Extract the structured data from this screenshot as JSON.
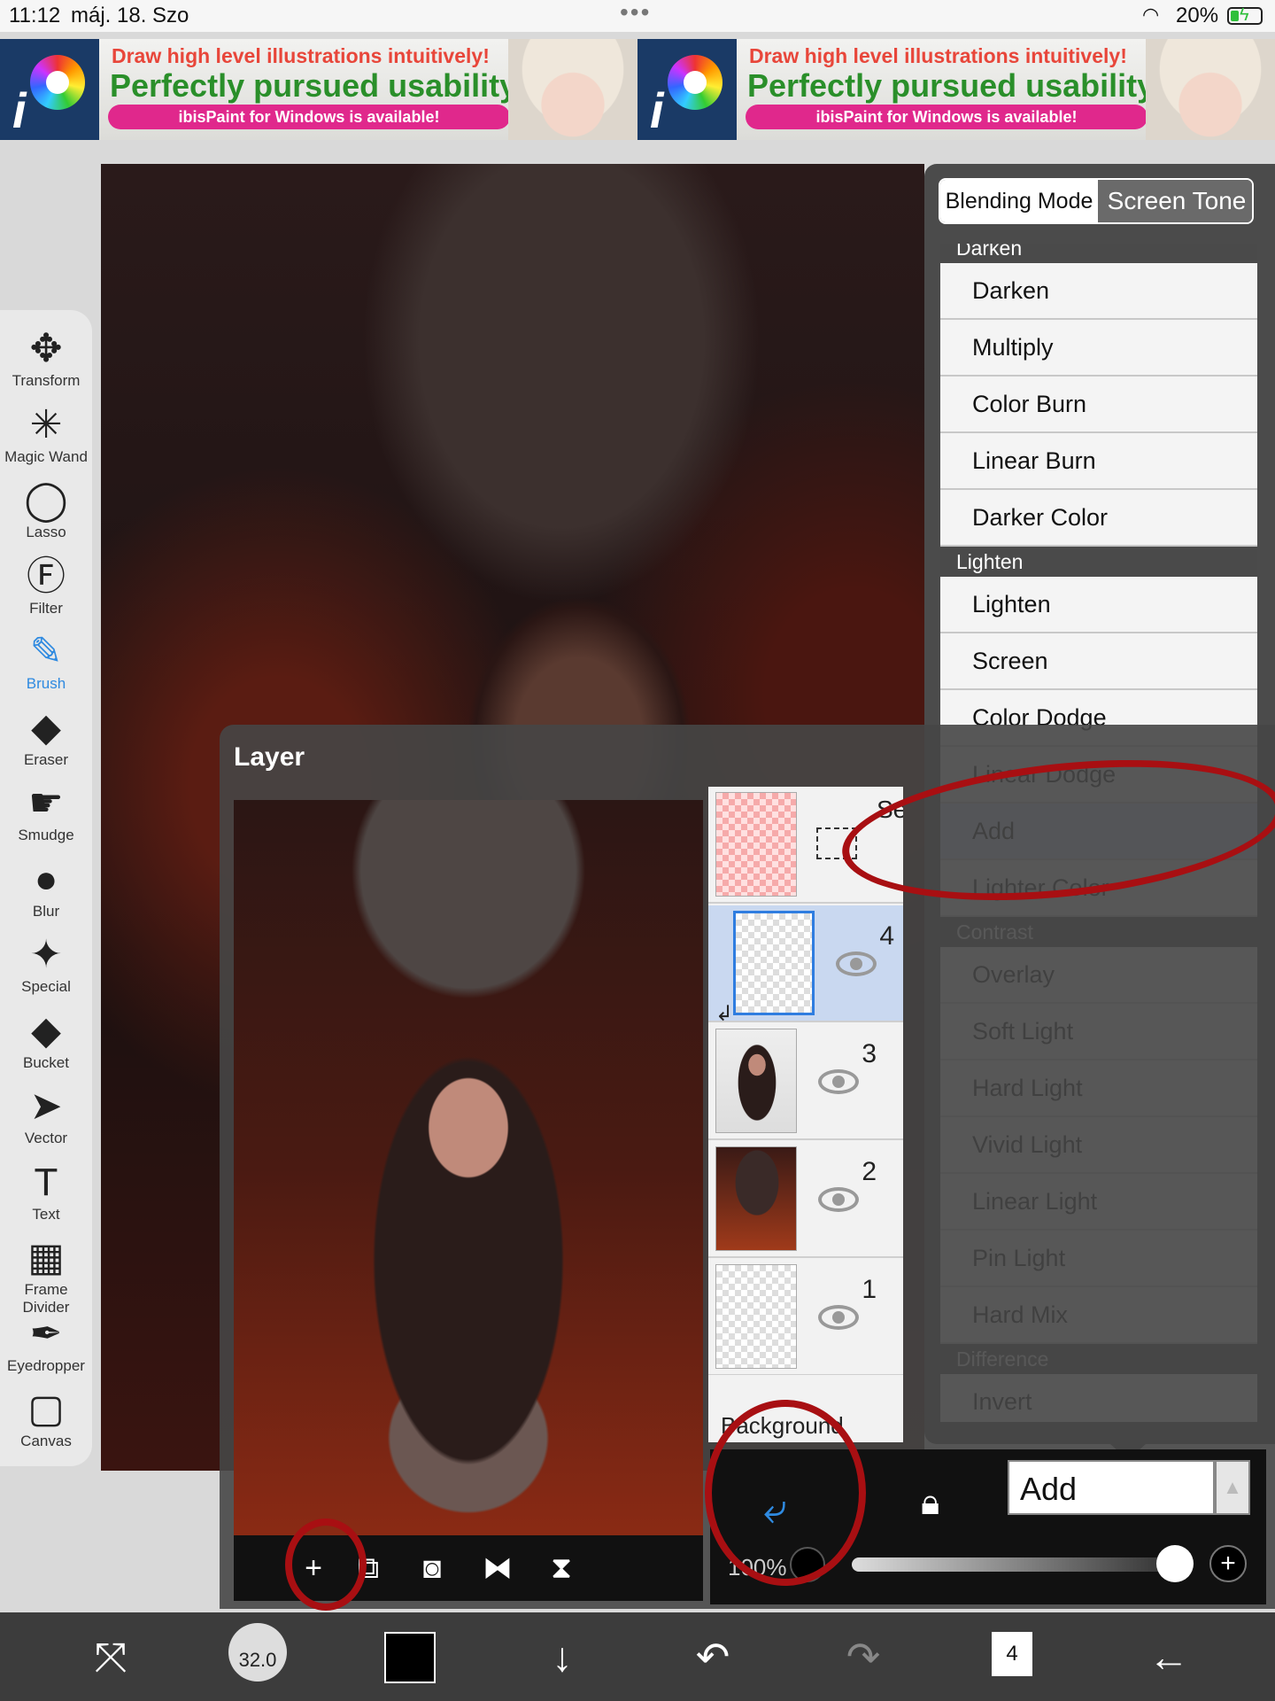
{
  "status": {
    "time": "11:12",
    "date": "máj. 18. Szo",
    "battery_pct": "20%",
    "battery_level": 0.2
  },
  "ad": {
    "line1": "Draw high level illustrations intuitively!",
    "line2": "Perfectly pursued usability!",
    "line3": "ibisPaint for Windows is available!"
  },
  "tools": [
    {
      "label": "Transform",
      "icon": "move-icon",
      "glyph": "✥"
    },
    {
      "label": "Magic Wand",
      "icon": "magic-wand-icon",
      "glyph": "✳"
    },
    {
      "label": "Lasso",
      "icon": "lasso-icon",
      "glyph": "◯"
    },
    {
      "label": "Filter",
      "icon": "filter-fx-icon",
      "glyph": "Ⓕ"
    },
    {
      "label": "Brush",
      "icon": "brush-icon",
      "glyph": "✎"
    },
    {
      "label": "Eraser",
      "icon": "eraser-icon",
      "glyph": "◆"
    },
    {
      "label": "Smudge",
      "icon": "smudge-icon",
      "glyph": "☛"
    },
    {
      "label": "Blur",
      "icon": "blur-drop-icon",
      "glyph": "●"
    },
    {
      "label": "Special",
      "icon": "special-icon",
      "glyph": "✦"
    },
    {
      "label": "Bucket",
      "icon": "bucket-icon",
      "glyph": "◆"
    },
    {
      "label": "Vector",
      "icon": "vector-cursor-icon",
      "glyph": "➤"
    },
    {
      "label": "Text",
      "icon": "text-icon",
      "glyph": "T"
    },
    {
      "label": "Frame Divider",
      "icon": "frame-divider-icon",
      "glyph": "▦"
    },
    {
      "label": "Eyedropper",
      "icon": "eyedropper-icon",
      "glyph": "✒"
    },
    {
      "label": "Canvas",
      "icon": "canvas-icon",
      "glyph": "▢"
    }
  ],
  "active_tool": "Brush",
  "layer_panel": {
    "title": "Layer",
    "selection_label": "Selec",
    "layers": [
      {
        "number": "4",
        "selected": true
      },
      {
        "number": "3",
        "selected": false
      },
      {
        "number": "2",
        "selected": false
      },
      {
        "number": "1",
        "selected": false
      }
    ],
    "background_label": "Background"
  },
  "blend": {
    "tabs": [
      "Blending Mode",
      "Screen Tone"
    ],
    "menu": [
      {
        "type": "header",
        "label": "Darken"
      },
      {
        "type": "item",
        "label": "Darken"
      },
      {
        "type": "item",
        "label": "Multiply"
      },
      {
        "type": "item",
        "label": "Color Burn"
      },
      {
        "type": "item",
        "label": "Linear Burn"
      },
      {
        "type": "item",
        "label": "Darker Color"
      },
      {
        "type": "header",
        "label": "Lighten"
      },
      {
        "type": "item",
        "label": "Lighten"
      },
      {
        "type": "item",
        "label": "Screen"
      },
      {
        "type": "item",
        "label": "Color Dodge"
      },
      {
        "type": "item",
        "label": "Linear Dodge"
      },
      {
        "type": "item",
        "label": "Add",
        "highlighted": true
      },
      {
        "type": "item",
        "label": "Lighter Color"
      },
      {
        "type": "header",
        "label": "Contrast"
      },
      {
        "type": "item",
        "label": "Overlay"
      },
      {
        "type": "item",
        "label": "Soft Light"
      },
      {
        "type": "item",
        "label": "Hard Light"
      },
      {
        "type": "item",
        "label": "Vivid Light"
      },
      {
        "type": "item",
        "label": "Linear Light"
      },
      {
        "type": "item",
        "label": "Pin Light"
      },
      {
        "type": "item",
        "label": "Hard Mix"
      },
      {
        "type": "header",
        "label": "Difference"
      },
      {
        "type": "item",
        "label": "Invert"
      }
    ],
    "current_mode": "Add"
  },
  "opacity": {
    "label": "100%",
    "value_pct": 100
  },
  "bottom_bar": {
    "brush_size": "32.0",
    "layer_count": "4",
    "color": "#000000"
  },
  "colors": {
    "accent": "#2f8ae0",
    "annotation_red": "#a80f12",
    "selected_row": "#c9d8f0",
    "highlight_item": "#d4e2f7"
  }
}
